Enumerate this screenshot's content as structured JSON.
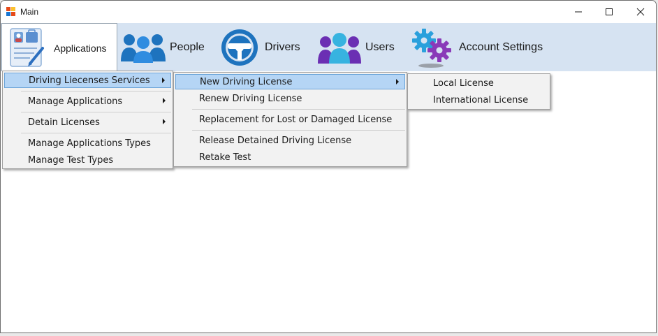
{
  "window": {
    "title": "Main"
  },
  "menu": {
    "items": [
      {
        "label": "Applications",
        "icon": "applications-icon"
      },
      {
        "label": "People",
        "icon": "people-icon"
      },
      {
        "label": "Drivers",
        "icon": "steering-wheel-icon"
      },
      {
        "label": "Users",
        "icon": "users-icon"
      },
      {
        "label": "Account Settings",
        "icon": "gears-icon"
      }
    ]
  },
  "applications_menu": {
    "items": [
      {
        "label": "Driving Liecenses Services"
      },
      {
        "label": "Manage Applications"
      },
      {
        "label": "Detain Licenses"
      },
      {
        "label": "Manage Applications Types"
      },
      {
        "label": "Manage Test Types"
      }
    ]
  },
  "driving_services_menu": {
    "items": [
      {
        "label": "New Driving License"
      },
      {
        "label": "Renew Driving License"
      },
      {
        "label": "Replacement for Lost or Damaged License"
      },
      {
        "label": "Release Detained Driving License"
      },
      {
        "label": "Retake Test"
      }
    ]
  },
  "new_license_menu": {
    "items": [
      {
        "label": "Local License"
      },
      {
        "label": "International License"
      }
    ]
  },
  "colors": {
    "menubar": "#d6e3f2",
    "highlight": "#b5d5f5",
    "accent": "#1e73be"
  }
}
